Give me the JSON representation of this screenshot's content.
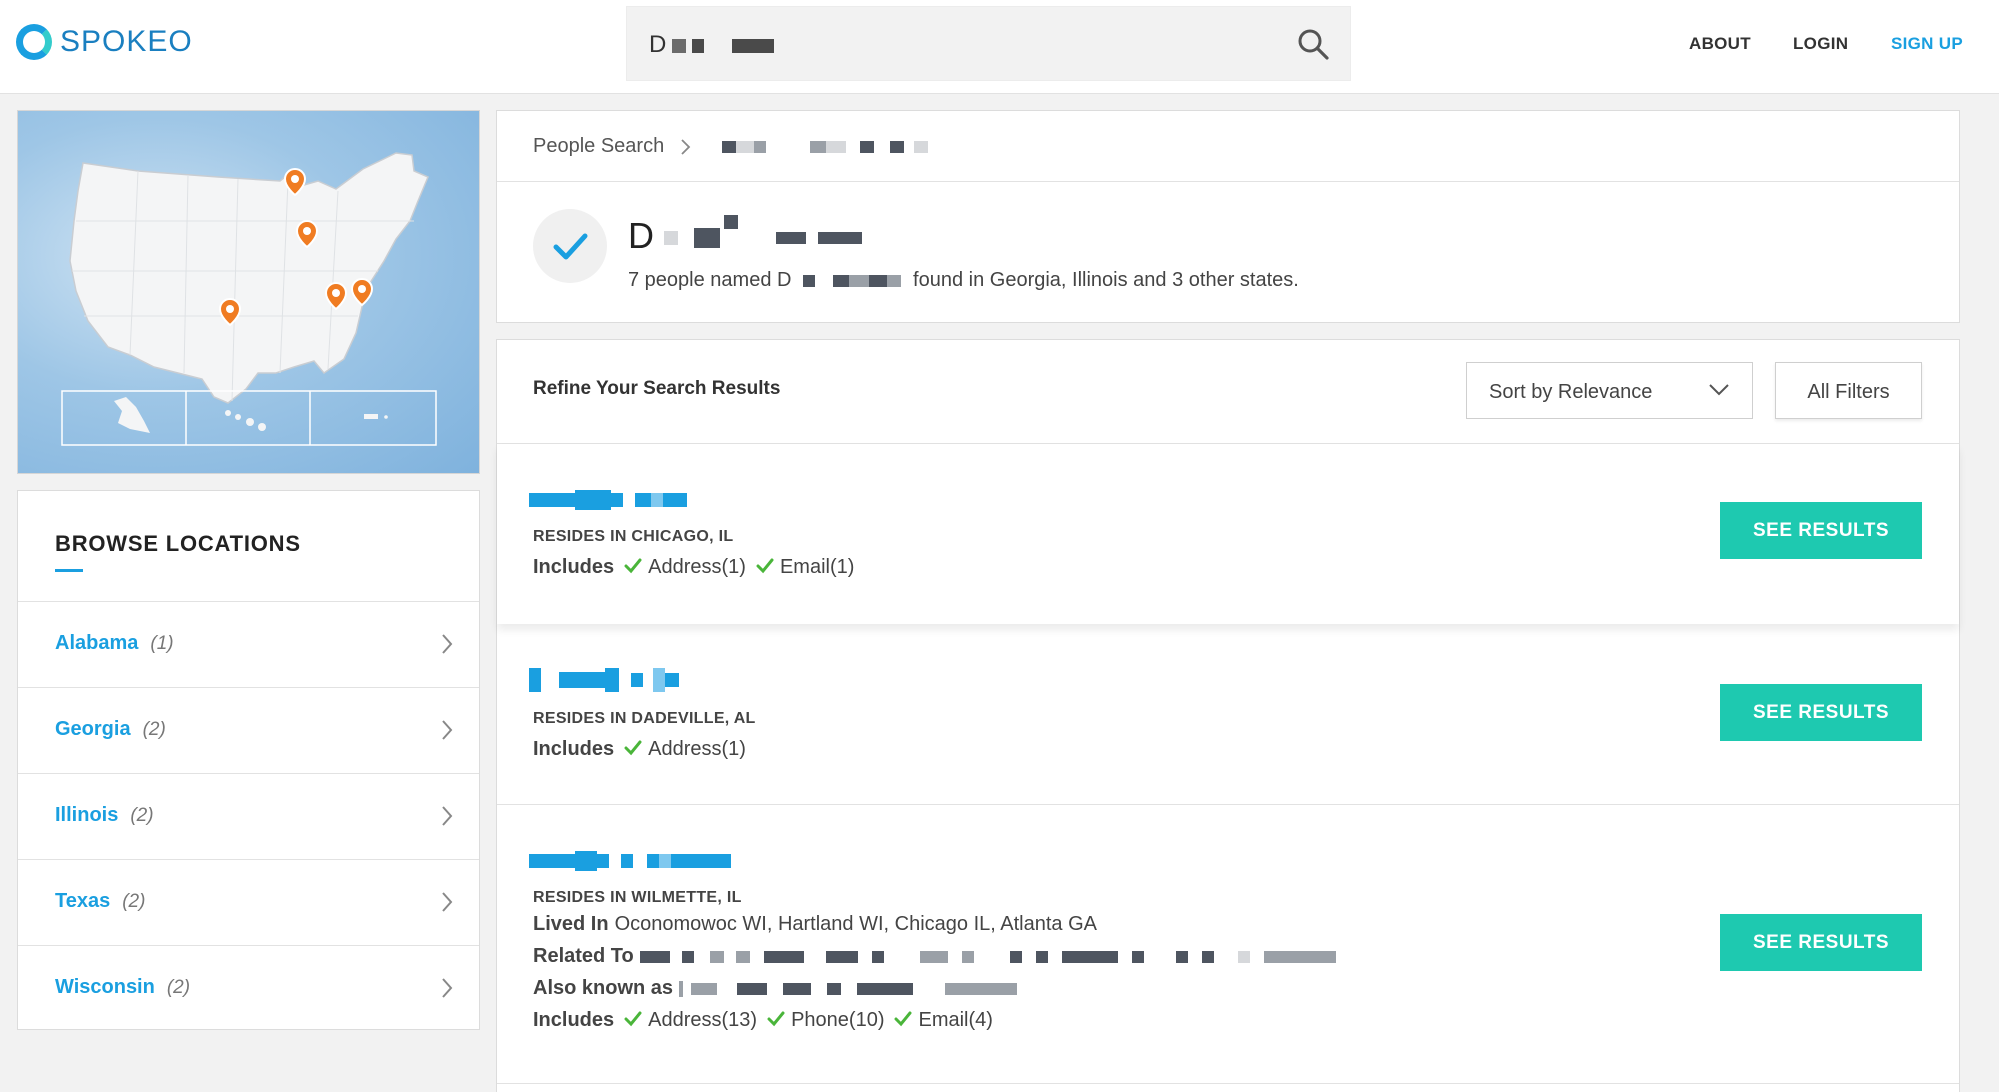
{
  "header": {
    "logo_text": "SPOKEO",
    "search_value": "D",
    "nav": {
      "about": "ABOUT",
      "login": "LOGIN",
      "signup": "SIGN UP"
    }
  },
  "browse": {
    "title": "BROWSE LOCATIONS",
    "items": [
      {
        "label": "Alabama",
        "count": "(1)"
      },
      {
        "label": "Georgia",
        "count": "(2)"
      },
      {
        "label": "Illinois",
        "count": "(2)"
      },
      {
        "label": "Texas",
        "count": "(2)"
      },
      {
        "label": "Wisconsin",
        "count": "(2)"
      }
    ]
  },
  "breadcrumb": {
    "root": "People Search"
  },
  "summary": {
    "name_initial": "D",
    "sub_prefix": "7 people named",
    "sub_initial": "D",
    "sub_suffix": "found in Georgia, Illinois and 3 other states."
  },
  "refine": {
    "title": "Refine Your Search Results",
    "sort_label": "Sort by Relevance",
    "filters_label": "All Filters"
  },
  "results": [
    {
      "resides": "RESIDES IN CHICAGO, IL",
      "includes_label": "Includes",
      "includes": [
        "Address(1)",
        "Email(1)"
      ],
      "button": "SEE RESULTS"
    },
    {
      "resides": "RESIDES IN DADEVILLE, AL",
      "includes_label": "Includes",
      "includes": [
        "Address(1)"
      ],
      "button": "SEE RESULTS"
    },
    {
      "resides": "RESIDES IN WILMETTE, IL",
      "lived_in_label": "Lived In",
      "lived_in": "Oconomowoc WI, Hartland WI, Chicago IL, Atlanta GA",
      "related_label": "Related To",
      "aka_label": "Also known as",
      "includes_label": "Includes",
      "includes": [
        "Address(13)",
        "Phone(10)",
        "Email(4)"
      ],
      "button": "SEE RESULTS"
    }
  ],
  "colors": {
    "brand_blue": "#1a9fe0",
    "cta_teal": "#1ec9b0",
    "check_green": "#4ab53a",
    "pin_orange": "#f07c22"
  }
}
